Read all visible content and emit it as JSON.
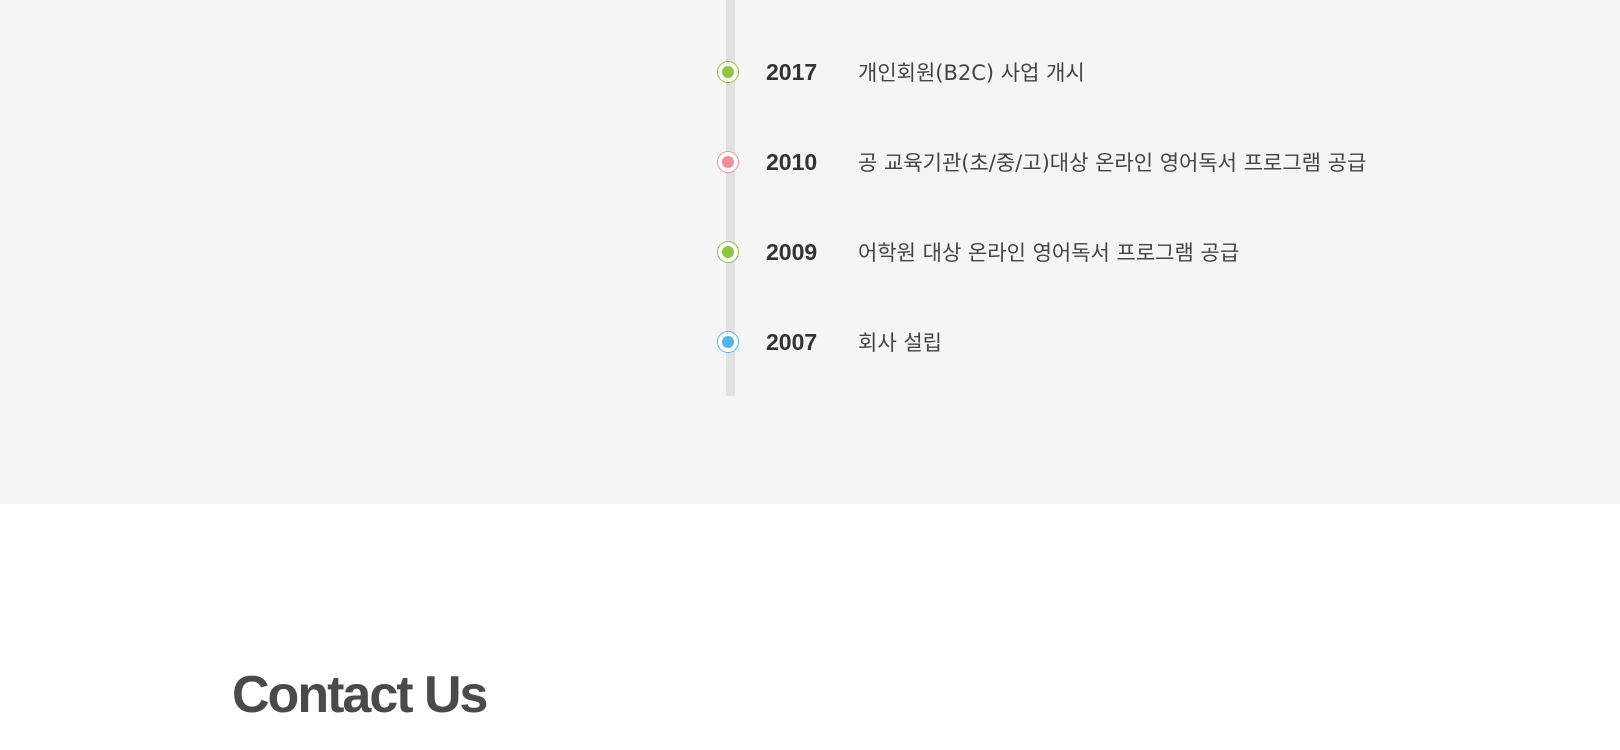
{
  "history": {
    "items": [
      {
        "year": "2017",
        "text": "개인회원(B2C) 사업 개시",
        "color": "#8dc63f"
      },
      {
        "year": "2010",
        "text": "공 교육기관(초/중/고)대상 온라인 영어독서 프로그램 공급",
        "color": "#f28b9a"
      },
      {
        "year": "2009",
        "text": "어학원  대상 온라인 영어독서 프로그램 공급",
        "color": "#8dc63f"
      },
      {
        "year": "2007",
        "text": "회사 설립",
        "color": "#4db6e8"
      }
    ]
  },
  "contact": {
    "title": "Contact Us"
  }
}
